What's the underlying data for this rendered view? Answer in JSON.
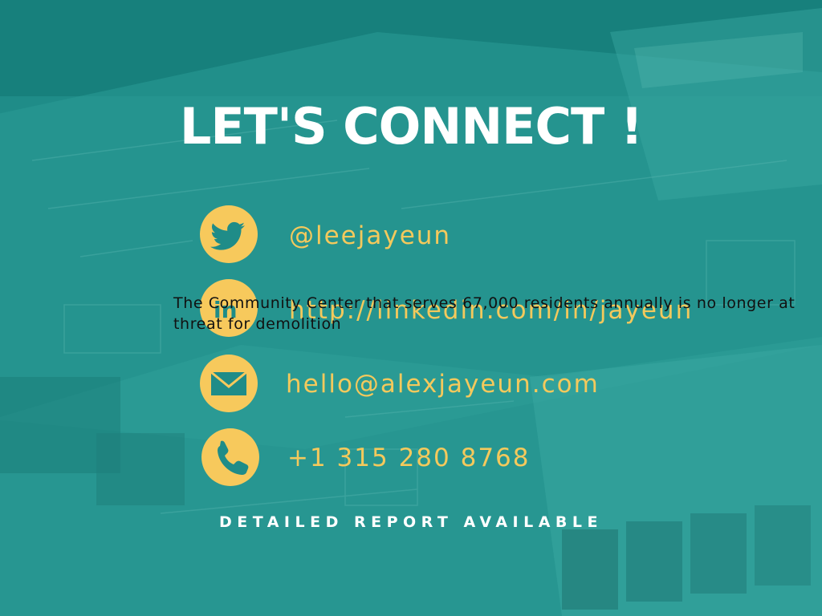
{
  "title": "LET'S CONNECT !",
  "contacts": {
    "twitter": {
      "icon": "twitter-bird-icon",
      "text": "@leejayeun"
    },
    "linkedin": {
      "icon": "linkedin-icon",
      "icon_text": "in",
      "text": "http://linkedin.com/in/jayeun"
    },
    "email": {
      "icon": "envelope-icon",
      "text": "hello@alexjayeun.com"
    },
    "phone": {
      "icon": "phone-icon",
      "text": "+1 315 280 8768"
    }
  },
  "overlay_text": "The Community Center that serves 67,000 residents annually is no longer at threat for demolition",
  "footer": "DETAILED REPORT AVAILABLE",
  "colors": {
    "background": "#1f8c88",
    "accent_yellow": "#f4c95c",
    "icon_circle": "#f7c95c",
    "title": "#ffffff",
    "overlay_text": "#111111"
  }
}
